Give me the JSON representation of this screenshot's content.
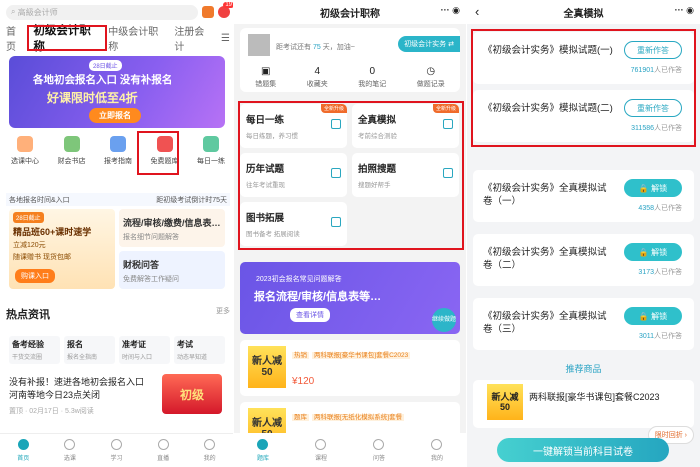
{
  "panel1": {
    "search_placeholder": "高級会计师",
    "bell_badge": "19",
    "tabs": [
      "首页",
      "初级会计职称",
      "中级会计职称",
      "注册会计"
    ],
    "banner": {
      "tag": "28日截止",
      "line1": "各地初会报名入口 没有补报名",
      "line2": "好课限时低至4折",
      "button": "立即报名"
    },
    "categories": [
      "选课中心",
      "财会书店",
      "报考指南",
      "免费题库",
      "每日一练"
    ],
    "notice": {
      "left": "各地报名时间&入口",
      "right": "距初级考试倒计时75天"
    },
    "promo1": {
      "tag": "28日截止",
      "title": "精品班60+课时速学",
      "sub1": "立减120元",
      "sub2": "随课赠书 现货包邮",
      "button": "购课入口"
    },
    "promo2": {
      "title": "流程/审核/缴费/信息表…",
      "sub": "报名细节问题解答"
    },
    "promo3": {
      "title": "财税问答",
      "sub": "免费解答工作疑问"
    },
    "hot_title": "热点资讯",
    "hot_more": "更多",
    "hot_cells": [
      {
        "a": "备考经验",
        "b": "干货交流圈"
      },
      {
        "a": "报名",
        "b": "报名全指南"
      },
      {
        "a": "准考证",
        "b": "时间与入口"
      },
      {
        "a": "考试",
        "b": "动态早知道"
      }
    ],
    "news": {
      "title": "没有补报！速进各地初会报名入口 河南等地今日23点关闭",
      "meta": "置顶 · 02月17日 · 5.3w阅读",
      "image_text": "初级"
    },
    "nav": [
      "首页",
      "选课",
      "学习",
      "直播",
      "我的"
    ]
  },
  "panel2": {
    "title": "初级会计职称",
    "profile": {
      "days_prefix": "距考试还有",
      "days": "75",
      "days_suffix": "天，加油~",
      "button": "初级会计实务 ⇄"
    },
    "stats": [
      {
        "v": "",
        "l": "错题集"
      },
      {
        "v": "4",
        "l": "收藏夹"
      },
      {
        "v": "0",
        "l": "我的笔记"
      },
      {
        "v": "",
        "l": "做题记录"
      }
    ],
    "cards": [
      {
        "t": "每日一练",
        "s": "每日练题，养习惯",
        "tag": "全新升级"
      },
      {
        "t": "全真模拟",
        "s": "考前综合测验",
        "tag": "全新升级"
      },
      {
        "t": "历年试题",
        "s": "往年考试重现",
        "tag": ""
      },
      {
        "t": "拍照搜题",
        "s": "搜题好帮手",
        "tag": ""
      },
      {
        "t": "图书拓展",
        "s": "图书备考 拓展阅读",
        "tag": ""
      }
    ],
    "banner": {
      "a": "2023初会报名常见问题解答",
      "b": "报名流程/审核/信息表等…",
      "c": "查看详情",
      "d": "继续做题"
    },
    "products": [
      {
        "tag": "热销",
        "title": "两科联报[豪华书课包]套餐C2023",
        "price": "¥120",
        "img": "新人减50"
      },
      {
        "tag": "题库",
        "title": "两科联报[无纸化模拟系统]套餐",
        "price": "",
        "img": "新人减50"
      }
    ],
    "nav": [
      "题库",
      "课程",
      "问答",
      "我的"
    ]
  },
  "panel3": {
    "title": "全真模拟",
    "items": [
      {
        "t": "《初级会计实务》模拟试题(一)",
        "btn": "重新作答",
        "kind": "redo",
        "count": "761901",
        "suffix": "人已作答"
      },
      {
        "t": "《初级会计实务》模拟试题(二)",
        "btn": "重新作答",
        "kind": "redo",
        "count": "311586",
        "suffix": "人已作答"
      },
      {
        "t": "《初级会计实务》全真模拟试卷（一）",
        "btn": "🔒 解锁",
        "kind": "unl",
        "count": "4358",
        "suffix": "人已作答"
      },
      {
        "t": "《初级会计实务》全真模拟试卷（二）",
        "btn": "🔒 解锁",
        "kind": "unl",
        "count": "3173",
        "suffix": "人已作答"
      },
      {
        "t": "《初级会计实务》全真模拟试卷（三）",
        "btn": "🔒 解锁",
        "kind": "unl",
        "count": "3011",
        "suffix": "人已作答"
      }
    ],
    "recommend": "推荐商品",
    "product": {
      "title": "两科联报[豪华书课包]套餐C2023",
      "img": "新人减50"
    },
    "limited": "限时回折 ›",
    "unlock_all": "一键解锁当前科目试卷"
  }
}
